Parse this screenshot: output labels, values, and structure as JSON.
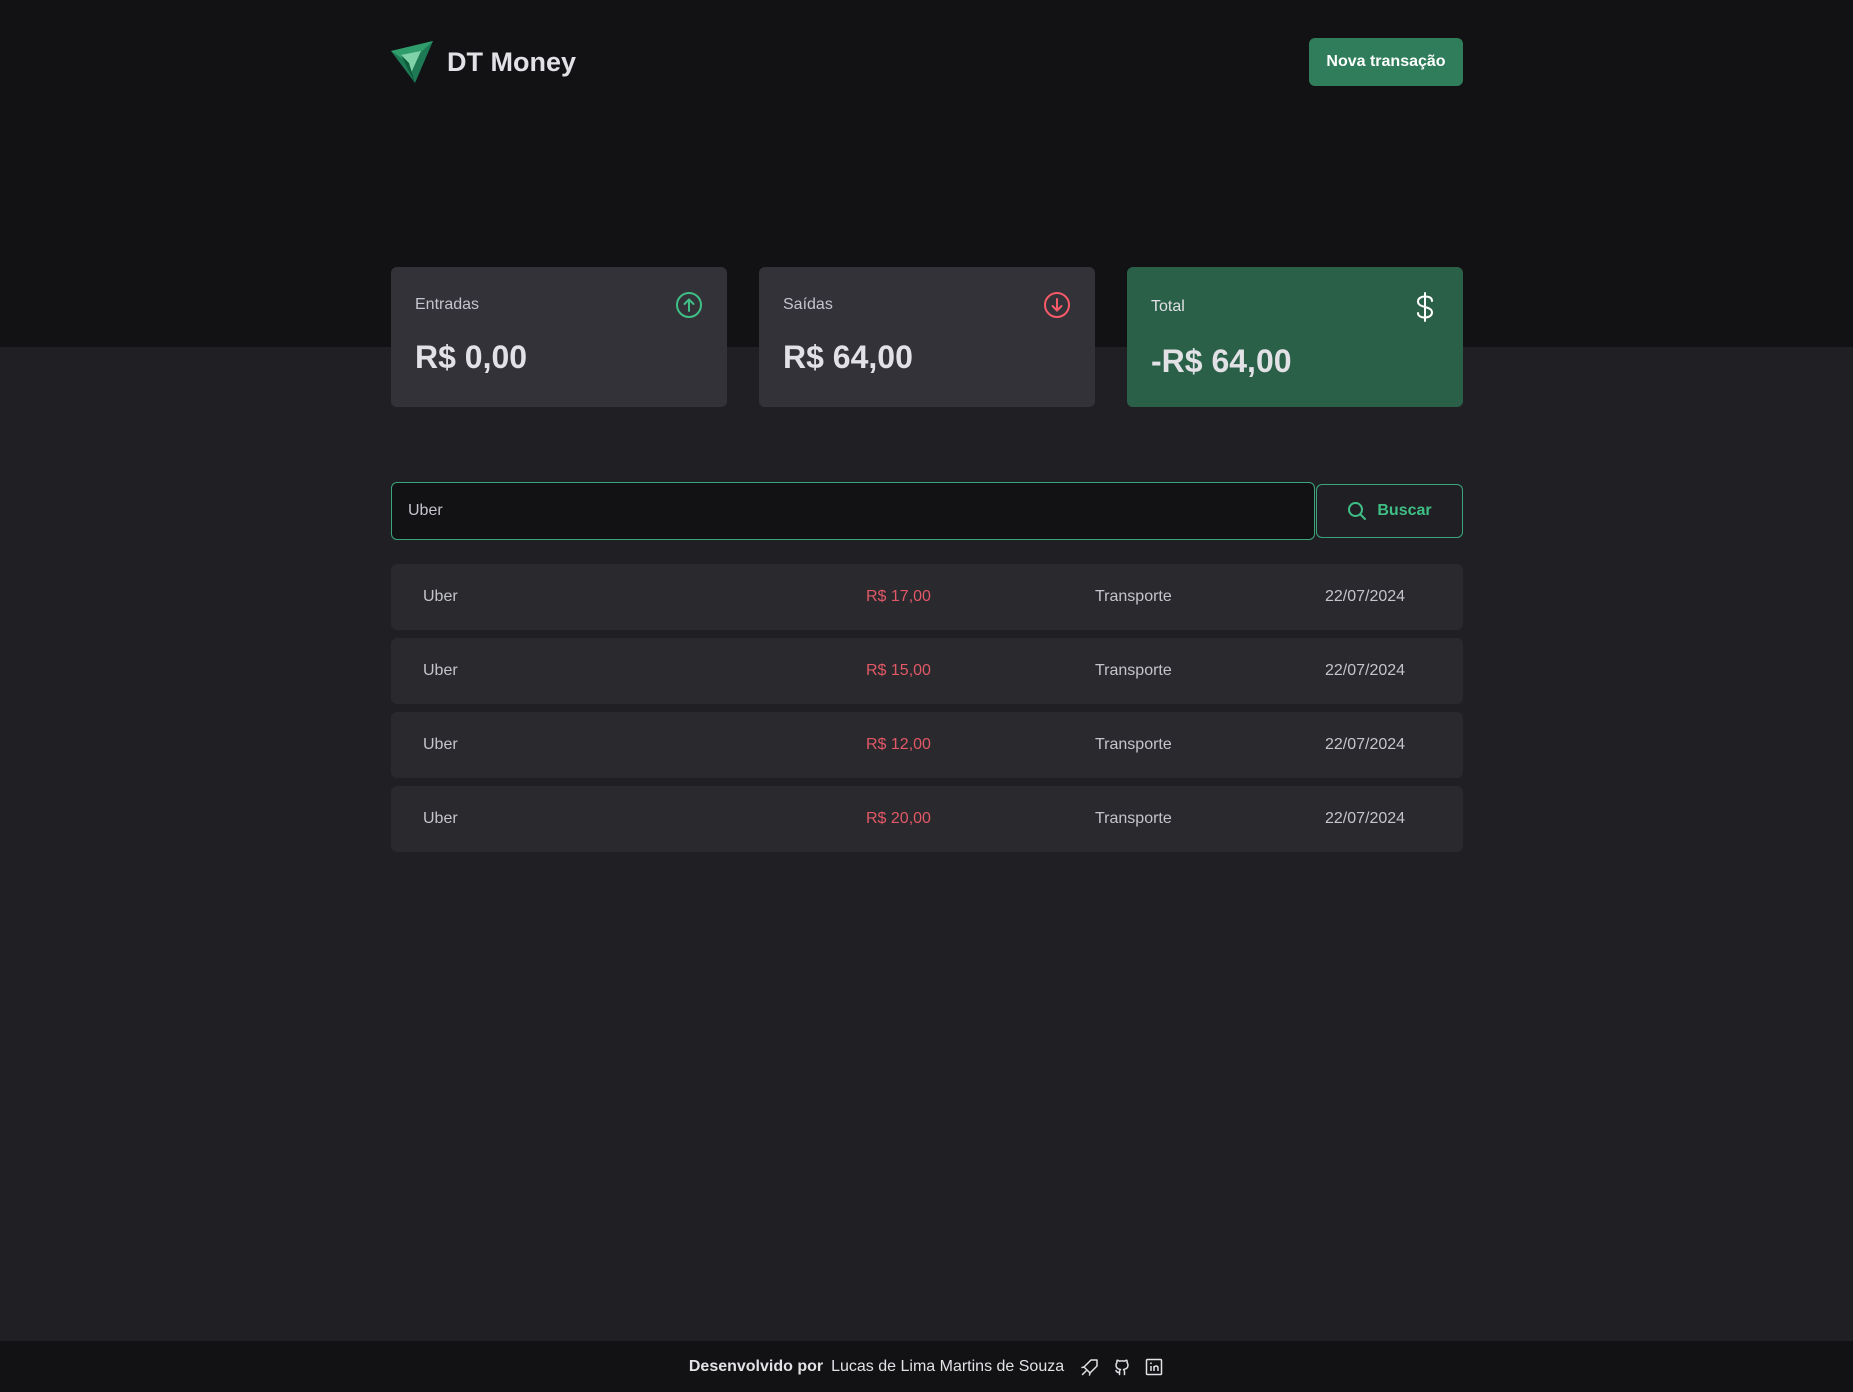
{
  "header": {
    "brand_name": "DT Money",
    "new_transaction_label": "Nova transação"
  },
  "summary": {
    "income": {
      "label": "Entradas",
      "value": "R$ 0,00",
      "icon": "arrow-circle-up-icon",
      "color": "#00b37e"
    },
    "outcome": {
      "label": "Saídas",
      "value": "R$ 64,00",
      "icon": "arrow-circle-down-icon",
      "color": "#f75a68"
    },
    "total": {
      "label": "Total",
      "value": "-R$ 64,00",
      "icon": "currency-dollar-icon",
      "color": "#00875f"
    }
  },
  "search": {
    "value": "Uber",
    "button_label": "Buscar"
  },
  "transactions": [
    {
      "description": "Uber",
      "price": "R$ 17,00",
      "category": "Transporte",
      "date": "22/07/2024"
    },
    {
      "description": "Uber",
      "price": "R$ 15,00",
      "category": "Transporte",
      "date": "22/07/2024"
    },
    {
      "description": "Uber",
      "price": "R$ 12,00",
      "category": "Transporte",
      "date": "22/07/2024"
    },
    {
      "description": "Uber",
      "price": "R$ 20,00",
      "category": "Transporte",
      "date": "22/07/2024"
    }
  ],
  "footer": {
    "prefix": "Desenvolvido por",
    "author": "Lucas de Lima Martins de Souza",
    "icons": [
      "rocket-icon",
      "github-icon",
      "linkedin-icon"
    ]
  }
}
